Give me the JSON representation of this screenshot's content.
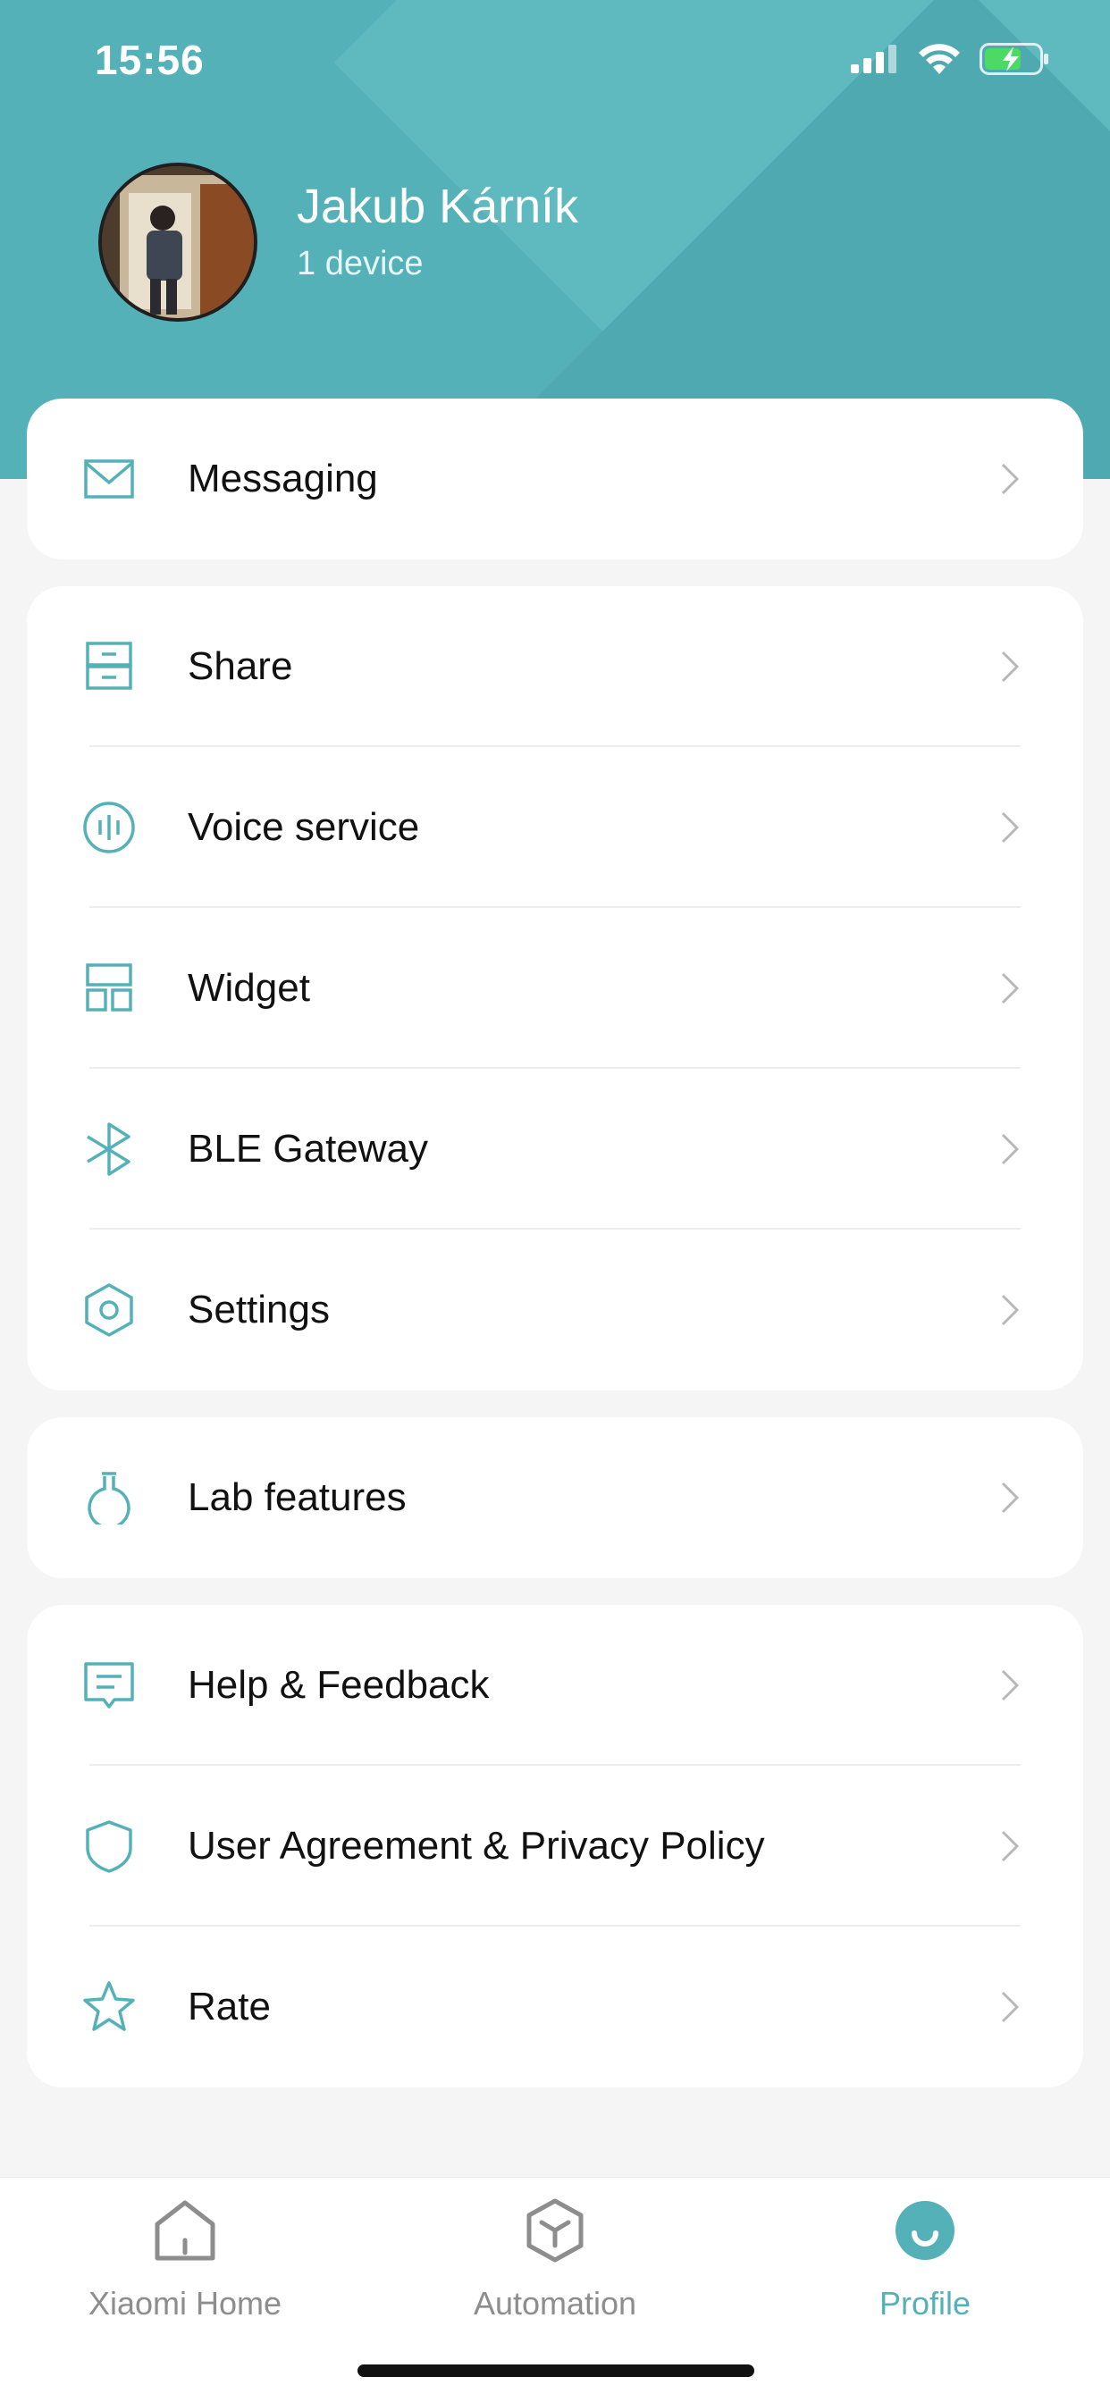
{
  "status_bar": {
    "time": "15:56",
    "icons": [
      "cellular-signal-icon",
      "wifi-icon",
      "battery-charging-icon"
    ]
  },
  "profile": {
    "name": "Jakub Kárník",
    "device_count": "1 device"
  },
  "colors": {
    "accent": "#55b1b8",
    "header_bg": "#55b1b8",
    "text": "#111111",
    "inactive_tab": "#8d8d8d",
    "battery_fill": "#4cd964"
  },
  "menu": {
    "group1": [
      {
        "label": "Messaging",
        "icon": "envelope-icon"
      }
    ],
    "group2": [
      {
        "label": "Share",
        "icon": "share-drawer-icon"
      },
      {
        "label": "Voice service",
        "icon": "voice-wave-icon"
      },
      {
        "label": "Widget",
        "icon": "widget-grid-icon"
      },
      {
        "label": "BLE Gateway",
        "icon": "bluetooth-icon"
      },
      {
        "label": "Settings",
        "icon": "settings-hexagon-icon"
      }
    ],
    "group3": [
      {
        "label": "Lab features",
        "icon": "lab-flask-icon"
      }
    ],
    "group4": [
      {
        "label": "Help & Feedback",
        "icon": "feedback-icon"
      },
      {
        "label": "User Agreement & Privacy Policy",
        "icon": "shield-icon"
      },
      {
        "label": "Rate",
        "icon": "star-icon"
      }
    ]
  },
  "tabs": [
    {
      "label": "Xiaomi Home",
      "icon": "home-icon",
      "active": false
    },
    {
      "label": "Automation",
      "icon": "automation-cube-icon",
      "active": false
    },
    {
      "label": "Profile",
      "icon": "profile-smile-icon",
      "active": true
    }
  ]
}
